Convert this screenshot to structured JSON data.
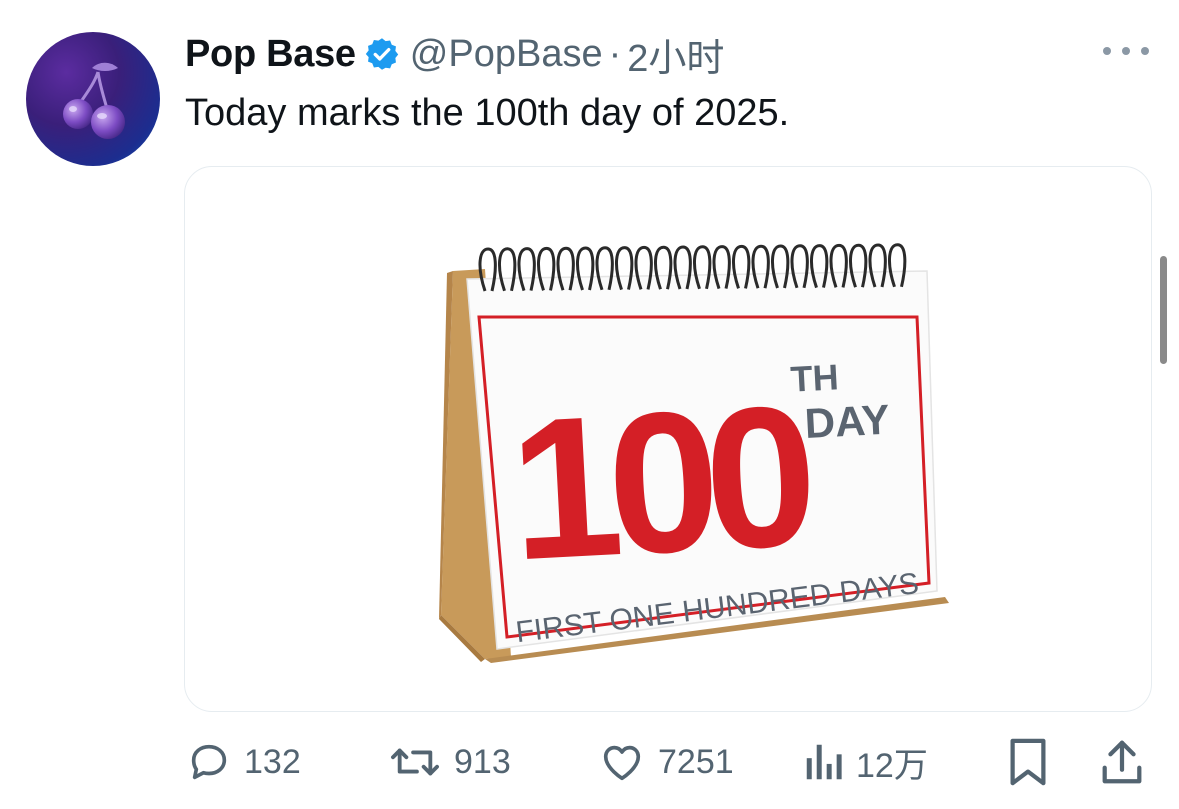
{
  "tweet": {
    "author": {
      "display_name": "Pop Base",
      "handle": "@PopBase",
      "separator": "·",
      "time": "2小时",
      "avatar_icon": "cherries-icon",
      "verified_icon": "verified-badge-icon"
    },
    "text": "Today marks the 100th day of 2025.",
    "more_icon": "more-options-icon"
  },
  "media": {
    "alt_icon": "desk-calendar-illustration",
    "calendar": {
      "number": "100",
      "suffix": "TH",
      "day_word": "DAY",
      "footer": "FIRST ONE HUNDRED DAYS"
    }
  },
  "actions": {
    "reply": {
      "icon": "reply-icon",
      "count": "132"
    },
    "retweet": {
      "icon": "retweet-icon",
      "count": "913"
    },
    "like": {
      "icon": "like-icon",
      "count": "7251"
    },
    "views": {
      "icon": "views-icon",
      "count": "12万"
    },
    "bookmark": {
      "icon": "bookmark-icon"
    },
    "share": {
      "icon": "share-icon"
    }
  },
  "colors": {
    "text": "#0f1419",
    "secondary": "#536471",
    "verified": "#1d9bf0",
    "calendar_red": "#d41f26",
    "calendar_gray": "#5a6470",
    "cardboard": "#c89a5a"
  }
}
